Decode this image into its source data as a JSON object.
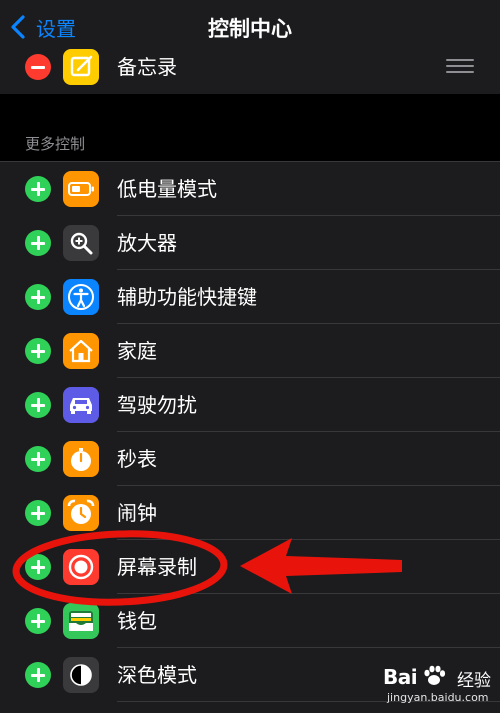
{
  "nav": {
    "back_label": "设置",
    "title": "控制中心"
  },
  "included": [
    {
      "label": "备忘录",
      "icon": "notes-icon",
      "color": "#ffcc00"
    }
  ],
  "more_controls": {
    "header": "更多控制",
    "items": [
      {
        "label": "低电量模式",
        "icon": "low-power-mode-icon",
        "color": "#ff9500"
      },
      {
        "label": "放大器",
        "icon": "magnifier-icon",
        "color": "#3a3a3c"
      },
      {
        "label": "辅助功能快捷键",
        "icon": "accessibility-icon",
        "color": "#0a84ff"
      },
      {
        "label": "家庭",
        "icon": "home-icon",
        "color": "#ff9500"
      },
      {
        "label": "驾驶勿扰",
        "icon": "car-icon",
        "color": "#5e5ce6"
      },
      {
        "label": "秒表",
        "icon": "stopwatch-icon",
        "color": "#ff9500"
      },
      {
        "label": "闹钟",
        "icon": "alarm-icon",
        "color": "#ff9500"
      },
      {
        "label": "屏幕录制",
        "icon": "screen-recording-icon",
        "color": "#ff3b30"
      },
      {
        "label": "钱包",
        "icon": "wallet-icon",
        "color": "#34c759"
      },
      {
        "label": "深色模式",
        "icon": "dark-mode-icon",
        "color": "#3a3a3c"
      }
    ]
  },
  "watermark": {
    "brand": "Bai",
    "brand_suffix": "经验",
    "url": "jingyan.baidu.com"
  }
}
